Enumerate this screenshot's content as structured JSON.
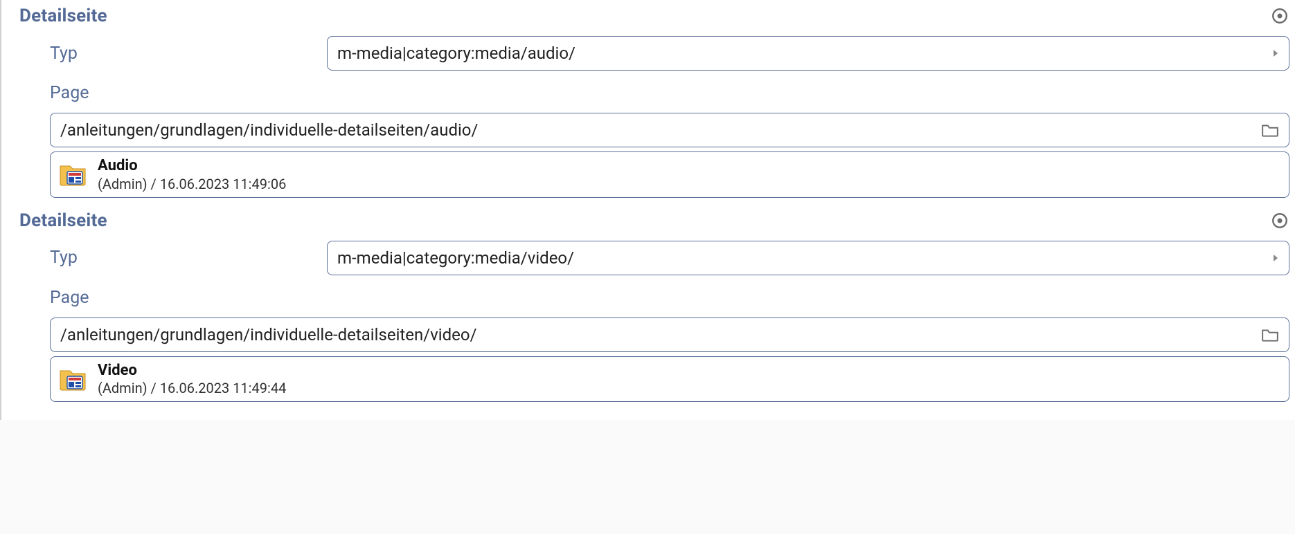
{
  "sections": [
    {
      "title": "Detailseite",
      "typ_label": "Typ",
      "typ_value": "m-media|category:media/audio/",
      "page_label": "Page",
      "page_path": "/anleitungen/grundlagen/individuelle-detailseiten/audio/",
      "resource_title": "Audio",
      "resource_meta": "(Admin) / 16.06.2023 11:49:06"
    },
    {
      "title": "Detailseite",
      "typ_label": "Typ",
      "typ_value": "m-media|category:media/video/",
      "page_label": "Page",
      "page_path": "/anleitungen/grundlagen/individuelle-detailseiten/video/",
      "resource_title": "Video",
      "resource_meta": "(Admin) / 16.06.2023 11:49:44"
    }
  ]
}
